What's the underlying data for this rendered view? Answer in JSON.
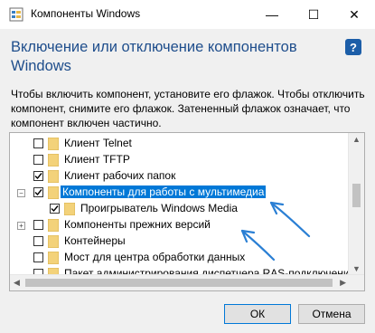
{
  "window": {
    "title": "Компоненты Windows",
    "minimize_glyph": "—",
    "maximize_glyph": "☐",
    "close_glyph": "✕"
  },
  "header": {
    "title": "Включение или отключение компонентов Windows",
    "help_glyph": "?"
  },
  "description": "Чтобы включить компонент, установите его флажок. Чтобы отключить компонент, снимите его флажок. Затененный флажок означает, что компонент включен частично.",
  "features": [
    {
      "label": "Клиент Telnet",
      "checked": false,
      "expandable": false
    },
    {
      "label": "Клиент TFTP",
      "checked": false,
      "expandable": false
    },
    {
      "label": "Клиент рабочих папок",
      "checked": true,
      "expandable": false
    },
    {
      "label": "Компоненты для работы с мультимедиа",
      "checked": true,
      "expandable": true,
      "expanded": true,
      "selected": true
    },
    {
      "label": "Проигрыватель Windows Media",
      "checked": true,
      "child": true
    },
    {
      "label": "Компоненты прежних версий",
      "checked": false,
      "expandable": true
    },
    {
      "label": "Контейнеры",
      "checked": false,
      "expandable": false
    },
    {
      "label": "Мост для центра обработки данных",
      "checked": false,
      "expandable": false
    },
    {
      "label": "Пакет администрирования диспетчера RAS-подключений",
      "checked": false,
      "expandable": false
    }
  ],
  "buttons": {
    "ok": "ОК",
    "cancel": "Отмена"
  },
  "colors": {
    "accent": "#0078d7",
    "heading": "#1f4e8c",
    "annotation": "#2a7fd4"
  }
}
